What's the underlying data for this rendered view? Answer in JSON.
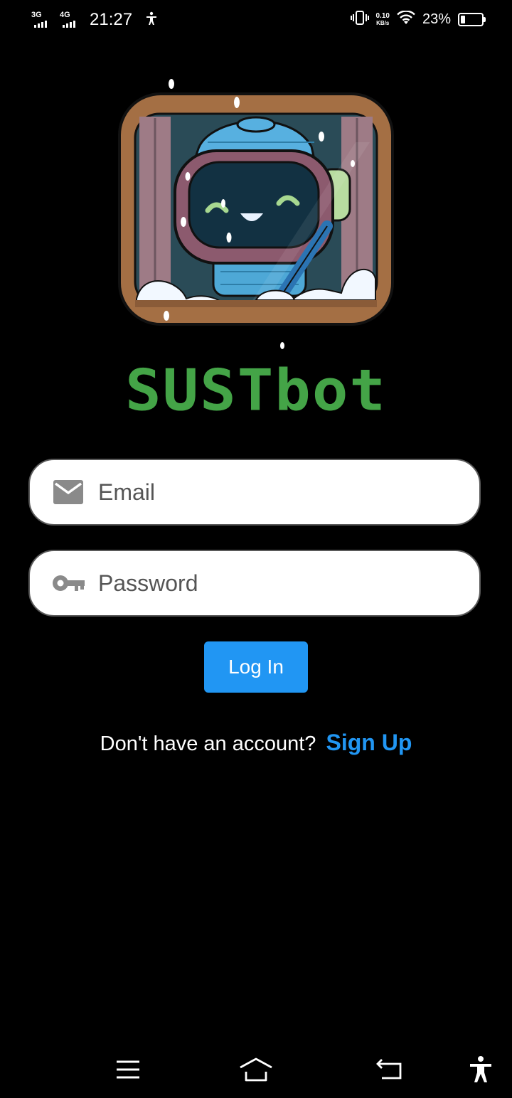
{
  "status_bar": {
    "network1": "3G",
    "network2": "4G",
    "time": "21:27",
    "speed_value": "0.10",
    "speed_unit": "KB/s",
    "battery_percent_text": "23%",
    "battery_level": 0.23
  },
  "app": {
    "brand_name": "SUSTbot",
    "logo_icon": "robot-mascot-window-logo"
  },
  "login_form": {
    "email_placeholder": "Email",
    "email_value": "",
    "email_icon": "envelope-icon",
    "password_placeholder": "Password",
    "password_value": "",
    "password_icon": "key-icon",
    "login_label": "Log In"
  },
  "signup": {
    "prompt": "Don't have an account?",
    "link_label": "Sign Up"
  },
  "colors": {
    "background": "#000000",
    "brand_green": "#44a447",
    "accent_blue": "#2196f3",
    "field_bg": "#ffffff"
  },
  "nav_bar": {
    "icons": [
      "menu-icon",
      "home-icon",
      "back-icon",
      "accessibility-icon"
    ]
  }
}
